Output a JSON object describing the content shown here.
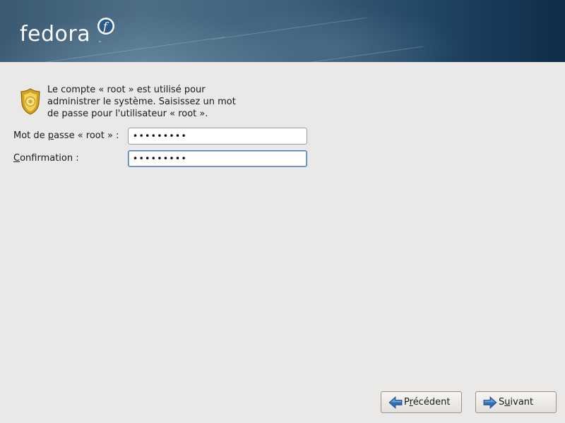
{
  "banner": {
    "logo_text": "fedora",
    "logo_mark": "f",
    "logo_trademark": "™"
  },
  "info": {
    "icon": "shield-badge-icon",
    "text": "Le compte « root » est utilisé pour\nadministrer le système. Saisissez un mot\nde passe pour l'utilisateur « root »."
  },
  "form": {
    "password": {
      "label_pre": "Mot de ",
      "label_mnemonic": "p",
      "label_post": "asse « root » :",
      "value": "•••••••••"
    },
    "confirm": {
      "label_mnemonic": "C",
      "label_post": "onfirmation :",
      "value": "•••••••••"
    }
  },
  "buttons": {
    "back": {
      "icon": "arrow-left-icon",
      "label_pre": "P",
      "label_mnemonic": "r",
      "label_post": "écédent"
    },
    "next": {
      "icon": "arrow-right-icon",
      "label_pre": "S",
      "label_mnemonic": "u",
      "label_post": "ivant"
    }
  },
  "colors": {
    "banner_dark": "#0f2c4a",
    "banner_light": "#4d6e86",
    "background": "#ebe9e7",
    "focus_border": "#4a7bb1",
    "arrow_blue": "#2f6db5"
  }
}
